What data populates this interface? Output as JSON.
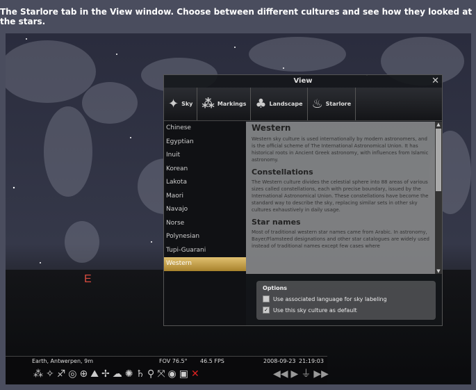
{
  "caption": "The Starlore tab in the View window. Choose between different cultures and see how they looked at the stars.",
  "sky": {
    "direction_label": "E"
  },
  "view": {
    "title": "View",
    "close": "✕",
    "tabs": [
      {
        "label": "Sky",
        "icon": "planets-icon"
      },
      {
        "label": "Markings",
        "icon": "constellation-lines-icon"
      },
      {
        "label": "Landscape",
        "icon": "tree-landscape-icon"
      },
      {
        "label": "Starlore",
        "icon": "campfire-icon"
      }
    ],
    "cultures": [
      "Chinese",
      "Egyptian",
      "Inuit",
      "Korean",
      "Lakota",
      "Maori",
      "Navajo",
      "Norse",
      "Polynesian",
      "Tupi-Guarani",
      "Western"
    ],
    "selected_culture": "Western",
    "description": {
      "title": "Western",
      "intro": "Western sky culture is used internationally by modern astronomers, and is the official scheme of The International Astronomical Union. It has historical roots in Ancient Greek astronomy, with influences from Islamic astronomy.",
      "section1_title": "Constellations",
      "section1_text": "The Western culture divides the celestial sphere into 88 areas of various sizes called constellations, each with precise boundary, issued by the International Astronomical Union. These constellations have become the standard way to describe the sky, replacing similar sets in other sky cultures exhaustively in daily usage.",
      "section2_title": "Star names",
      "section2_text": "Most of traditional western star names came from Arabic. In astronomy, Bayer/Flamsteed designations and other star catalogues are widely used instead of traditional names except few cases where"
    },
    "options": {
      "title": "Options",
      "opt1": "Use associated language for sky labeling",
      "opt1_checked": false,
      "opt2": "Use this sky culture as default",
      "opt2_checked": true
    }
  },
  "bottombar": {
    "location": "Earth, Antwerpen, 9m",
    "fov": "FOV 76.5°",
    "fps": "46.5 FPS",
    "date": "2008-09-23",
    "time": "21:19:03"
  }
}
